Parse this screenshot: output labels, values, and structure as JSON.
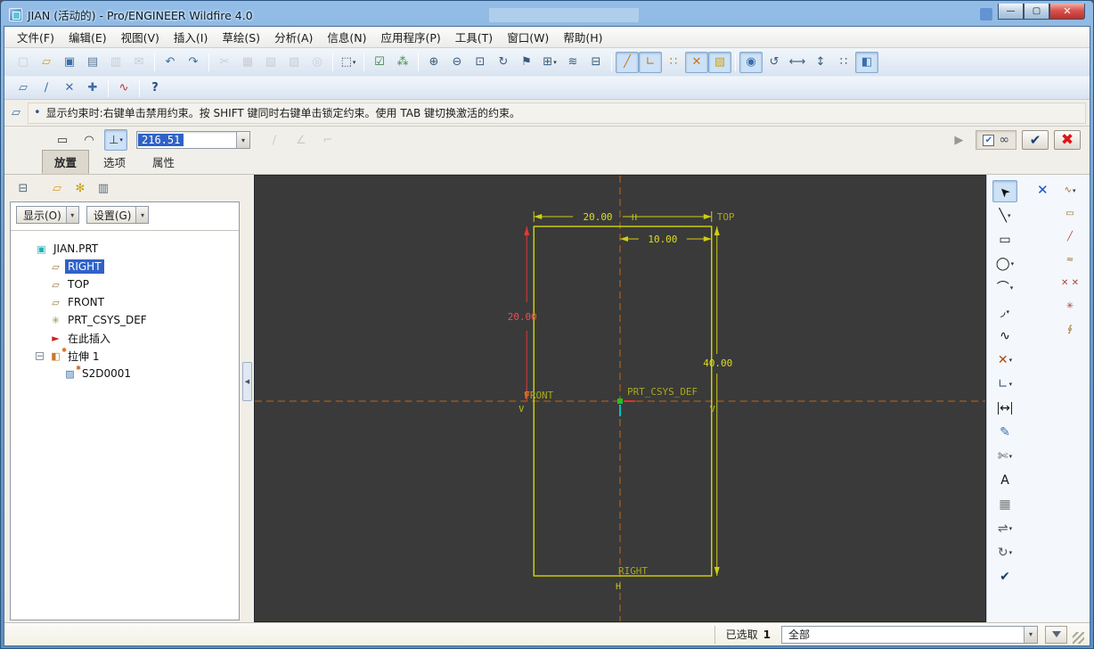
{
  "window": {
    "title": "JIAN (活动的) - Pro/ENGINEER Wildfire 4.0",
    "controls": [
      {
        "name": "minimize-button",
        "glyph": "—"
      },
      {
        "name": "maximize-button",
        "glyph": "▢"
      },
      {
        "name": "close-button",
        "glyph": "✕"
      }
    ]
  },
  "menu": {
    "items": [
      {
        "name": "menu-file",
        "label": "文件(F)"
      },
      {
        "name": "menu-edit",
        "label": "编辑(E)"
      },
      {
        "name": "menu-view",
        "label": "视图(V)"
      },
      {
        "name": "menu-insert",
        "label": "插入(I)"
      },
      {
        "name": "menu-sketch",
        "label": "草绘(S)"
      },
      {
        "name": "menu-analysis",
        "label": "分析(A)"
      },
      {
        "name": "menu-info",
        "label": "信息(N)"
      },
      {
        "name": "menu-applications",
        "label": "应用程序(P)"
      },
      {
        "name": "menu-tools",
        "label": "工具(T)"
      },
      {
        "name": "menu-window",
        "label": "窗口(W)"
      },
      {
        "name": "menu-help",
        "label": "帮助(H)"
      }
    ]
  },
  "toolbar1": {
    "items": [
      {
        "name": "new-file-button",
        "glyph": "▢",
        "color": "#98a2ae",
        "disabled": true
      },
      {
        "name": "open-file-button",
        "glyph": "▱",
        "color": "#d89a2c"
      },
      {
        "name": "save-button",
        "glyph": "▣",
        "color": "#3b6ea8"
      },
      {
        "name": "print-button",
        "glyph": "▤",
        "color": "#5a7a9a"
      },
      {
        "name": "print-related-button",
        "glyph": "▥",
        "color": "#98a2ae",
        "disabled": true
      },
      {
        "name": "mail-button",
        "glyph": "✉",
        "color": "#98a2ae",
        "disabled": true
      },
      {
        "sep": true
      },
      {
        "name": "undo-button",
        "glyph": "↶",
        "color": "#3b6ea8"
      },
      {
        "name": "redo-button",
        "glyph": "↷",
        "color": "#3b6ea8"
      },
      {
        "sep": true
      },
      {
        "name": "cut-button",
        "glyph": "✂",
        "color": "#98a2ae",
        "disabled": true
      },
      {
        "name": "copy-button",
        "glyph": "▦",
        "color": "#98a2ae",
        "disabled": true
      },
      {
        "name": "paste-button",
        "glyph": "▧",
        "color": "#98a2ae",
        "disabled": true
      },
      {
        "name": "paste-special-button",
        "glyph": "▨",
        "color": "#98a2ae",
        "disabled": true
      },
      {
        "name": "search-button",
        "glyph": "◎",
        "color": "#98a2ae",
        "disabled": true
      },
      {
        "sep": true
      },
      {
        "name": "select-box-button",
        "glyph": "⬚",
        "color": "#39424c",
        "dropdown": true
      },
      {
        "sep": true
      },
      {
        "name": "sketcher-diagnostics-button",
        "glyph": "☑",
        "color": "#2d7a2d"
      },
      {
        "name": "shade-closed-loops-button",
        "glyph": "⁂",
        "color": "#3c8a3c"
      },
      {
        "sep": true
      },
      {
        "name": "zoom-in-button",
        "glyph": "⊕",
        "color": "#3b5a7a"
      },
      {
        "name": "zoom-out-button",
        "glyph": "⊖",
        "color": "#3b5a7a"
      },
      {
        "name": "refit-button",
        "glyph": "⊡",
        "color": "#3b5a7a"
      },
      {
        "name": "repaint-button",
        "glyph": "↻",
        "color": "#3b5a7a"
      },
      {
        "name": "orient-mode-button",
        "glyph": "⚑",
        "color": "#3b5a7a"
      },
      {
        "name": "saved-views-button",
        "glyph": "⊞",
        "color": "#3b5a7a",
        "dropdown": true
      },
      {
        "name": "layers-button",
        "glyph": "≋",
        "color": "#3b5a7a"
      },
      {
        "name": "view-manager-button",
        "glyph": "⊟",
        "color": "#3b5a7a"
      },
      {
        "sep": true
      },
      {
        "name": "dim-display-toggle",
        "glyph": "╱",
        "color": "#c8741c",
        "pressed": true
      },
      {
        "name": "constraint-display-toggle",
        "glyph": "∟",
        "color": "#c8741c",
        "pressed": true
      },
      {
        "name": "grid-display-toggle",
        "glyph": "∷",
        "color": "#c8741c"
      },
      {
        "name": "vertex-display-toggle",
        "glyph": "✕",
        "color": "#c8741c",
        "pressed": true
      },
      {
        "name": "shade-display-toggle",
        "glyph": "▨",
        "color": "#c8a41c",
        "pressed": true
      },
      {
        "sep": true
      },
      {
        "name": "sketcher-shade-button",
        "glyph": "◉",
        "color": "#3b6ea8",
        "pressed": true
      },
      {
        "name": "regenerate-button",
        "glyph": "↺",
        "color": "#3b5a7a"
      },
      {
        "name": "fit-width-button",
        "glyph": "⟷",
        "color": "#3b5a7a"
      },
      {
        "name": "fit-height-button",
        "glyph": "↕",
        "color": "#3b5a7a"
      },
      {
        "name": "grid-snap-button",
        "glyph": "∷",
        "color": "#4a5668"
      },
      {
        "name": "sketch-orient-button",
        "glyph": "◧",
        "color": "#3b6ea8",
        "pressed": true
      }
    ]
  },
  "toolbar2": {
    "items": [
      {
        "name": "datum-planes-toggle",
        "glyph": "▱",
        "color": "#3b6ea8"
      },
      {
        "name": "datum-axes-toggle",
        "glyph": "∕",
        "color": "#3b6ea8"
      },
      {
        "name": "datum-points-toggle",
        "glyph": "✕",
        "color": "#3b6ea8"
      },
      {
        "name": "datum-csys-toggle",
        "glyph": "✚",
        "color": "#3b6ea8"
      },
      {
        "sep": true
      },
      {
        "name": "style-tool-button",
        "glyph": "∿",
        "color": "#c03030"
      },
      {
        "sep": true
      },
      {
        "name": "context-help-button",
        "glyph": "?",
        "color": "#2a4a8a",
        "bold": true
      }
    ]
  },
  "message": {
    "text": "显示约束时:右键单击禁用约束。按 SHIFT 键同时右键单击锁定约束。使用 TAB 键切换激活的约束。"
  },
  "dashboard": {
    "value": "216.51",
    "left_tools": [
      {
        "name": "dash-rect-button",
        "glyph": "▭",
        "color": "#333333"
      },
      {
        "name": "dash-arc-button",
        "glyph": "◠",
        "color": "#333333"
      },
      {
        "name": "dash-perp-button",
        "glyph": "⊥",
        "color": "#333333",
        "pressed": true,
        "dropdown": true
      }
    ],
    "disabled_tools": [
      {
        "name": "dash-line-button",
        "glyph": "∕",
        "color": "#999999",
        "disabled": true
      },
      {
        "name": "dash-angle-button",
        "glyph": "∠",
        "color": "#999999",
        "disabled": true
      },
      {
        "name": "dash-corner-button",
        "glyph": "⌐",
        "color": "#999999",
        "disabled": true
      }
    ],
    "resume_glyph": "▶",
    "ok_glyph": "✔",
    "cancel_glyph": "✖",
    "preview_check_glyph": "✔",
    "glasses_glyph": "∞",
    "tabs": [
      {
        "name": "tab-placement",
        "label": "放置",
        "pressed": true
      },
      {
        "name": "tab-options",
        "label": "选项"
      },
      {
        "name": "tab-properties",
        "label": "属性"
      }
    ]
  },
  "tree": {
    "toolbar": [
      {
        "name": "tree-switch-button",
        "glyph": "⊟",
        "color": "#556a7e"
      },
      {
        "gap": true
      },
      {
        "name": "tree-show-folder-button",
        "glyph": "▱",
        "color": "#d89a2c"
      },
      {
        "name": "tree-favorites-button",
        "glyph": "✻",
        "color": "#c8a020"
      },
      {
        "name": "tree-filter-button",
        "glyph": "▥",
        "color": "#556a7e"
      }
    ],
    "show_button": "显示(O)",
    "settings_button": "设置(G)",
    "items": [
      {
        "name": "tree-item-part",
        "label": "JIAN.PRT",
        "icon_glyph": "▣",
        "icon_color": "#28b0b0",
        "level": 0
      },
      {
        "name": "tree-item-right",
        "label": "RIGHT",
        "icon_glyph": "▱",
        "icon_color": "#9a7a3a",
        "level": 1,
        "selected": true
      },
      {
        "name": "tree-item-top",
        "label": "TOP",
        "icon_glyph": "▱",
        "icon_color": "#9a7a3a",
        "level": 1
      },
      {
        "name": "tree-item-front",
        "label": "FRONT",
        "icon_glyph": "▱",
        "icon_color": "#9a7a3a",
        "level": 1
      },
      {
        "name": "tree-item-csys",
        "label": "PRT_CSYS_DEF",
        "icon_glyph": "✳",
        "icon_color": "#909048",
        "level": 1
      },
      {
        "name": "tree-item-insert-here",
        "label": "在此插入",
        "icon_glyph": "►",
        "icon_color": "#cc2222",
        "level": 1
      },
      {
        "name": "tree-item-extrude",
        "label": "拉伸 1",
        "icon_glyph": "◧",
        "icon_color": "#c87828",
        "level": 1,
        "expander": "−",
        "star": true
      },
      {
        "name": "tree-item-sketch",
        "label": "S2D0001",
        "icon_glyph": "▨",
        "icon_color": "#3b6ea8",
        "level": 2,
        "star": true
      }
    ]
  },
  "canvas": {
    "dims": {
      "width": "20.00",
      "offset": "10.00",
      "left": "20.00",
      "height": "40.00"
    },
    "labels": {
      "top": "TOP",
      "front": "FRONT",
      "right": "RIGHT",
      "csys": "PRT_CSYS_DEF"
    },
    "marks": {
      "h_top": "H",
      "h_bottom": "H",
      "v_left": "V",
      "v_right": "V"
    }
  },
  "right_toolbar": {
    "close_glyph": "✕",
    "main": [
      {
        "name": "select-tool",
        "glyph": "➤",
        "rot": -135,
        "color": "#111111",
        "pressed": true
      },
      {
        "name": "line-tool",
        "glyph": "╲",
        "color": "#111111",
        "dropdown": true
      },
      {
        "name": "rectangle-tool",
        "glyph": "▭",
        "color": "#111111"
      },
      {
        "name": "circle-tool",
        "glyph": "◯",
        "color": "#111111",
        "dropdown": true
      },
      {
        "name": "arc-tool",
        "glyph": "⌒",
        "color": "#111111",
        "dropdown": true
      },
      {
        "name": "fillet-tool",
        "glyph": "◞",
        "color": "#111111",
        "dropdown": true
      },
      {
        "name": "spline-tool",
        "glyph": "∿",
        "color": "#111111"
      },
      {
        "name": "point-tool",
        "glyph": "✕",
        "color": "#b04a10",
        "dropdown": true
      },
      {
        "name": "use-edge-tool",
        "glyph": "∟",
        "color": "#3b5a7a",
        "dropdown": true
      },
      {
        "name": "dimension-tool",
        "glyph": "↔",
        "color": "#111111",
        "cls": "caps"
      },
      {
        "name": "modify-tool",
        "glyph": "✎",
        "color": "#3b6ea8"
      },
      {
        "name": "trim-tool",
        "glyph": "✄",
        "color": "#555555",
        "dropdown": true
      },
      {
        "name": "text-tool",
        "glyph": "A",
        "color": "#111111"
      },
      {
        "name": "palette-tool",
        "glyph": "▦",
        "color": "#777777"
      },
      {
        "name": "mirror-tool",
        "glyph": "⇌",
        "color": "#555555",
        "dropdown": true
      },
      {
        "name": "rotate-resize-tool",
        "glyph": "↻",
        "color": "#555555",
        "dropdown": true
      },
      {
        "name": "done-button",
        "glyph": "✔",
        "color": "#17406e"
      }
    ],
    "recent": [
      {
        "name": "flyout-spline-tool",
        "glyph": "∿",
        "color": "#9a6a20",
        "dropdown": true
      },
      {
        "name": "flyout-rect-tool",
        "glyph": "▭",
        "color": "#9a6a20"
      },
      {
        "name": "flyout-line-tool",
        "glyph": "╱",
        "color": "#b04040"
      },
      {
        "name": "flyout-wave-tool",
        "glyph": "≈",
        "color": "#9a6a20"
      },
      {
        "name": "flyout-points-tool",
        "glyph": "✕ ✕",
        "color": "#b04040"
      },
      {
        "name": "flyout-burst-tool",
        "glyph": "✳",
        "color": "#b04040"
      },
      {
        "name": "flyout-chain-tool",
        "glyph": "∮",
        "color": "#9a6a20"
      }
    ]
  },
  "status": {
    "selected_label": "已选取",
    "selected_count": "1",
    "filter_value": "全部"
  }
}
